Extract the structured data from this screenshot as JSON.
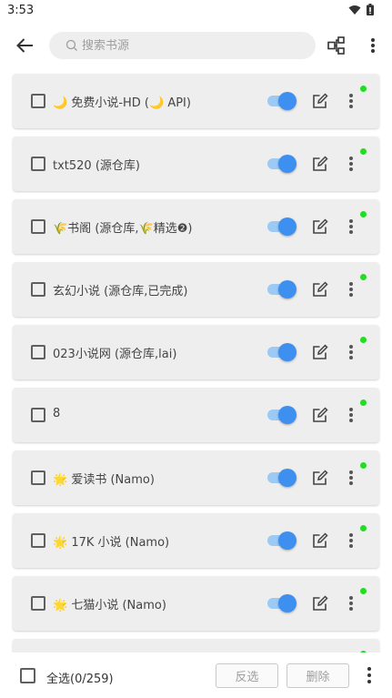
{
  "status_bar": {
    "time": "3:53",
    "icons": [
      "wifi-icon",
      "battery-icon"
    ]
  },
  "toolbar": {
    "search_placeholder": "搜索书源",
    "icons": [
      "back-arrow-icon",
      "search-icon",
      "tree-icon",
      "more-vert-icon"
    ]
  },
  "sources": [
    {
      "name": "🌙 免费小说-HD (🌙 API)",
      "enabled": true,
      "status": "#22dd22"
    },
    {
      "name": "txt520 (源仓库)",
      "enabled": true,
      "status": "#22dd22"
    },
    {
      "name": "🌾书阁 (源仓库,🌾精选❷)",
      "enabled": true,
      "status": "#22dd22"
    },
    {
      "name": "玄幻小说 (源仓库,已完成)",
      "enabled": true,
      "status": "#22dd22"
    },
    {
      "name": "023小说网 (源仓库,lai)",
      "enabled": true,
      "status": "#22dd22"
    },
    {
      "name": "8",
      "enabled": true,
      "status": "#22dd22"
    },
    {
      "name": "🌟 爱读书 (Namo)",
      "enabled": true,
      "status": "#22dd22"
    },
    {
      "name": "🌟 17K 小说 (Namo)",
      "enabled": true,
      "status": "#22dd22"
    },
    {
      "name": "🌟 七猫小说 (Namo)",
      "enabled": true,
      "status": "#22dd22"
    },
    {
      "name": "",
      "enabled": true,
      "status": "#22dd22"
    }
  ],
  "bottom_bar": {
    "select_all": "全选(0/259)",
    "invert": "反选",
    "delete": "删除"
  },
  "colors": {
    "accent": "#3d8ff0",
    "toggle_track": "#9ccaf5",
    "card_bg": "#eeeeee",
    "status_ok": "#22dd22"
  }
}
